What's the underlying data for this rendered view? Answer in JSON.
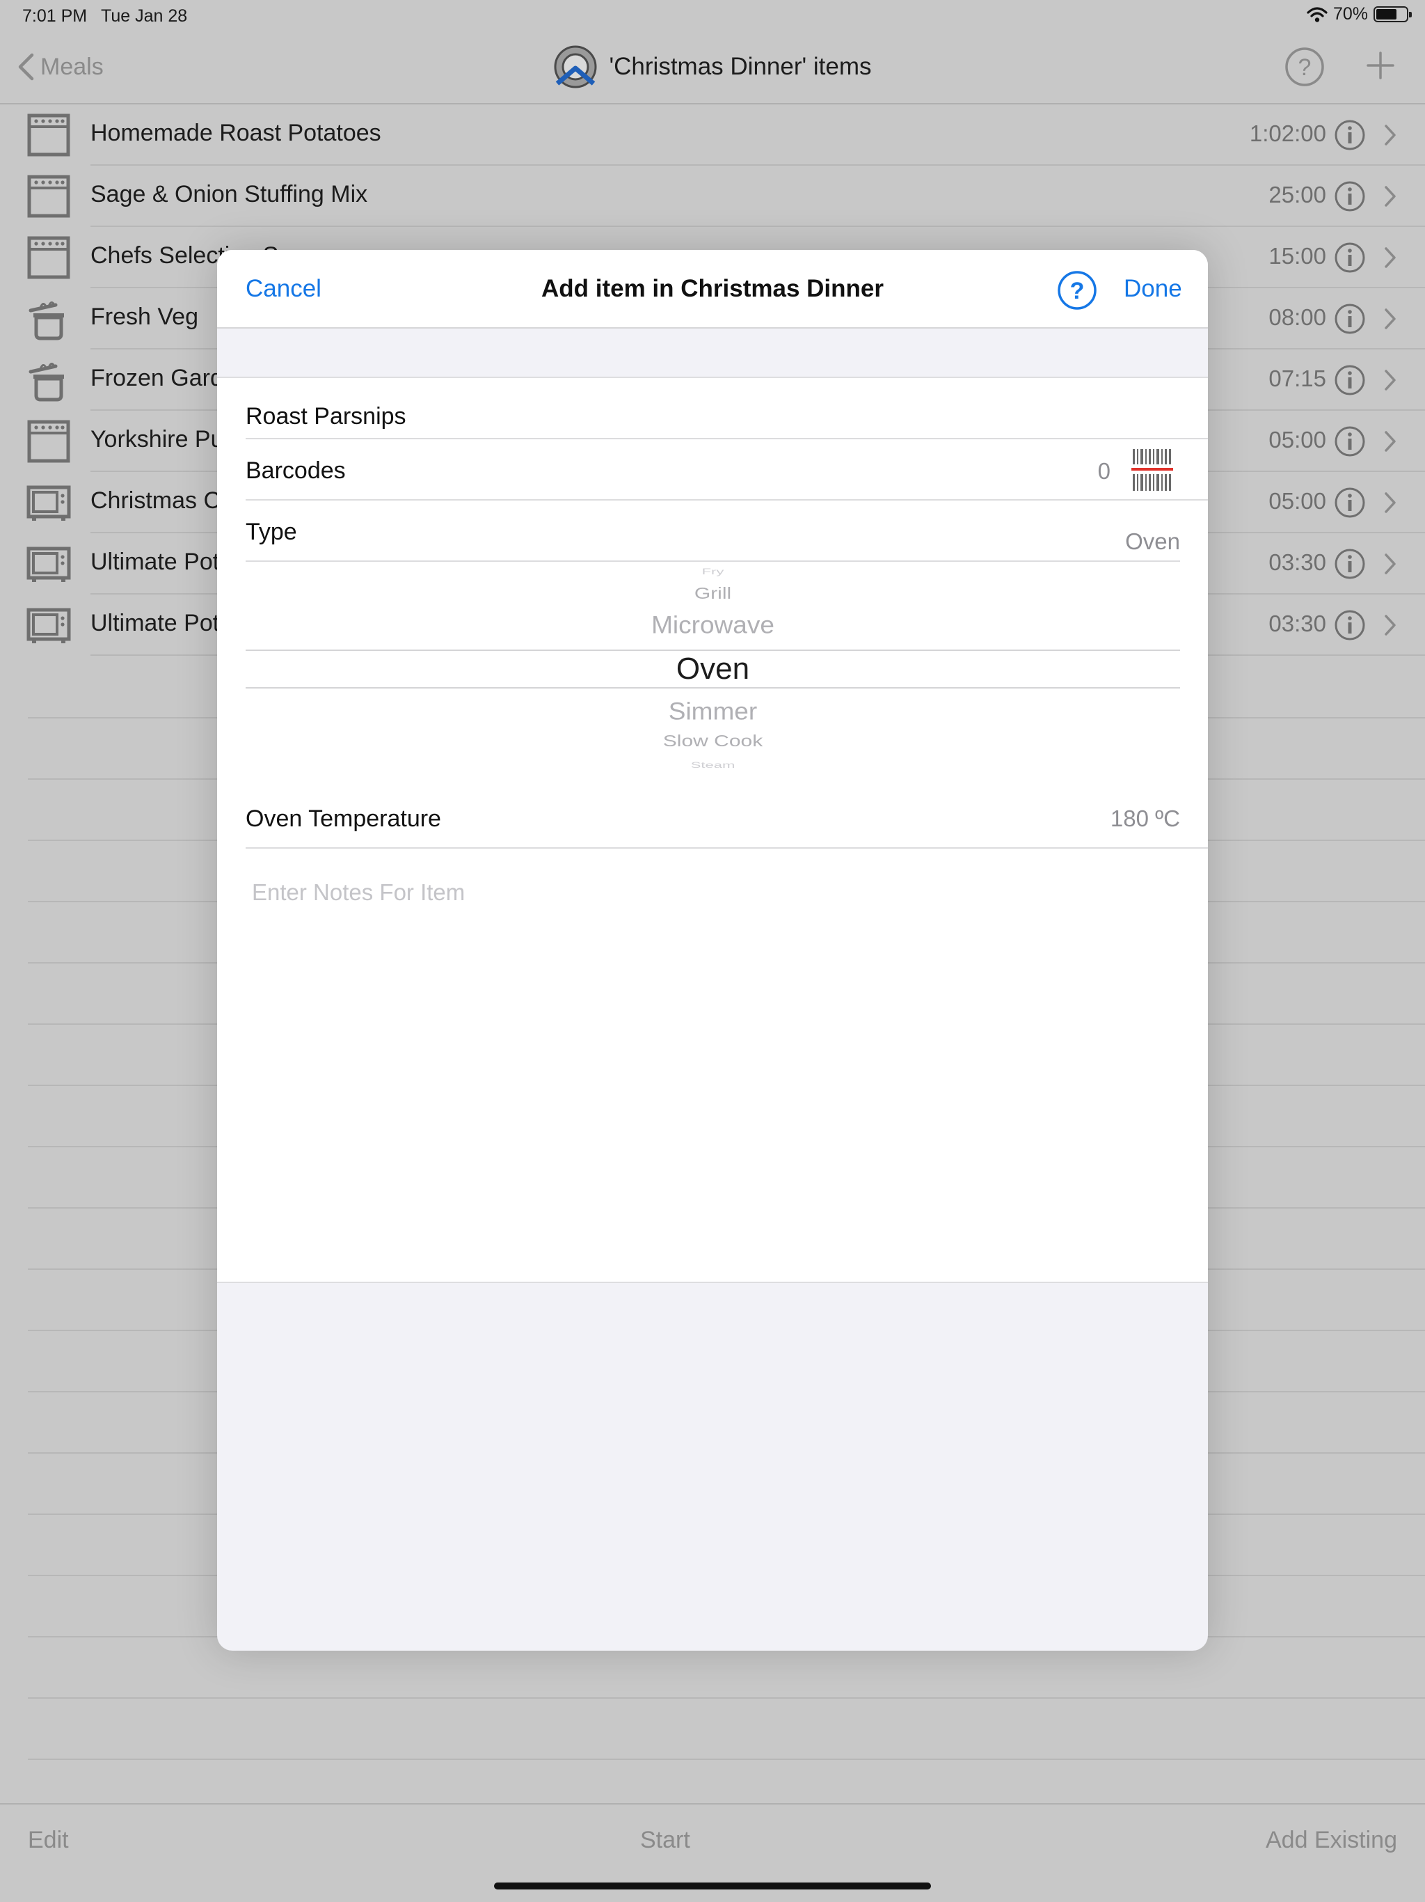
{
  "status_bar": {
    "time": "7:01 PM",
    "date": "Tue Jan 28",
    "battery_percent": "70%",
    "battery_level": 0.7
  },
  "nav": {
    "back_label": "Meals",
    "title": "'Christmas Dinner' items"
  },
  "list": {
    "items": [
      {
        "label": "Homemade Roast Potatoes",
        "time": "1:02:00",
        "icon": "oven-icon"
      },
      {
        "label": "Sage & Onion Stuffing Mix",
        "time": "25:00",
        "icon": "oven-icon"
      },
      {
        "label": "Chefs Selection S",
        "time": "15:00",
        "icon": "oven-icon"
      },
      {
        "label": "Fresh Veg",
        "time": "08:00",
        "icon": "saucepan-icon"
      },
      {
        "label": "Frozen Gard",
        "time": "07:15",
        "icon": "saucepan-icon"
      },
      {
        "label": "Yorkshire Pu",
        "time": "05:00",
        "icon": "oven-icon"
      },
      {
        "label": "Christmas C",
        "time": "05:00",
        "icon": "microwave-icon"
      },
      {
        "label": "Ultimate Pot",
        "time": "03:30",
        "icon": "microwave-icon"
      },
      {
        "label": "Ultimate Pot",
        "time": "03:30",
        "icon": "microwave-icon"
      }
    ]
  },
  "toolbar": {
    "edit_label": "Edit",
    "start_label": "Start",
    "add_existing_label": "Add Existing"
  },
  "modal": {
    "cancel_label": "Cancel",
    "title": "Add item in Christmas Dinner",
    "done_label": "Done",
    "name_value": "Roast Parsnips",
    "barcodes_label": "Barcodes",
    "barcodes_count": "0",
    "type_label": "Type",
    "type_value": "Oven",
    "picker_options": [
      "Fry",
      "Grill",
      "Microwave",
      "Oven",
      "Simmer",
      "Slow Cook",
      "Steam"
    ],
    "picker_selected": "Oven",
    "oven_temp_label": "Oven Temperature",
    "oven_temp_value": "180 ºC",
    "notes_placeholder": "Enter Notes For Item"
  },
  "colors": {
    "accent": "#1577e6",
    "barcode_scan_line": "#e0322b",
    "dimmed_background": "#c8c8c8"
  }
}
